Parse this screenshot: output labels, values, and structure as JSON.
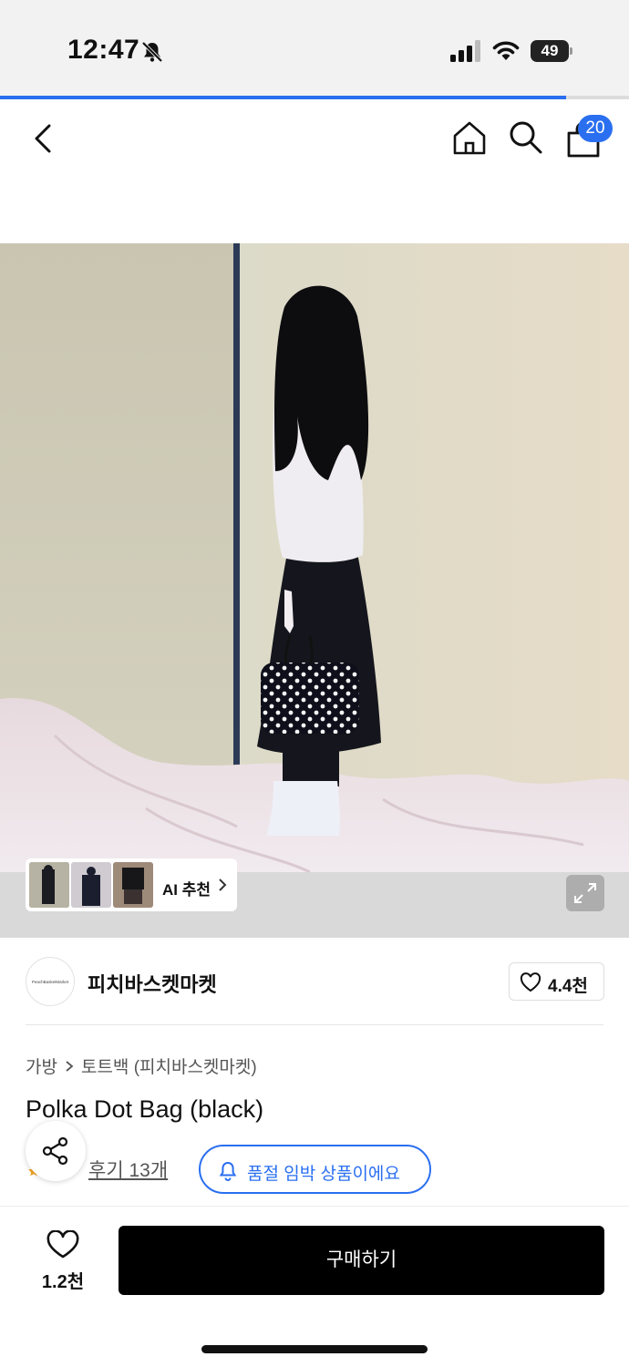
{
  "status_bar": {
    "time": "12:47",
    "battery": "49"
  },
  "page_progress": 0.9,
  "nav": {
    "cart_count": "20"
  },
  "hero": {
    "ai_recommend_label": "AI 추천"
  },
  "seller": {
    "logo_text": "PeachBasketMarket",
    "name": "피치바스켓마켓",
    "likes": "4.4천"
  },
  "breadcrumb": {
    "category": "가방",
    "subcategory": "토트백 (피치바스켓마켓)"
  },
  "product": {
    "title": "Polka Dot Bag (black)",
    "reviews": "후기 13개",
    "soldout_notice": "품절 임박 상품이에요"
  },
  "bottom_bar": {
    "wishlist_count": "1.2천",
    "buy_label": "구매하기"
  },
  "colors": {
    "accent": "#2a6ff0",
    "buy_button": "#000000"
  }
}
